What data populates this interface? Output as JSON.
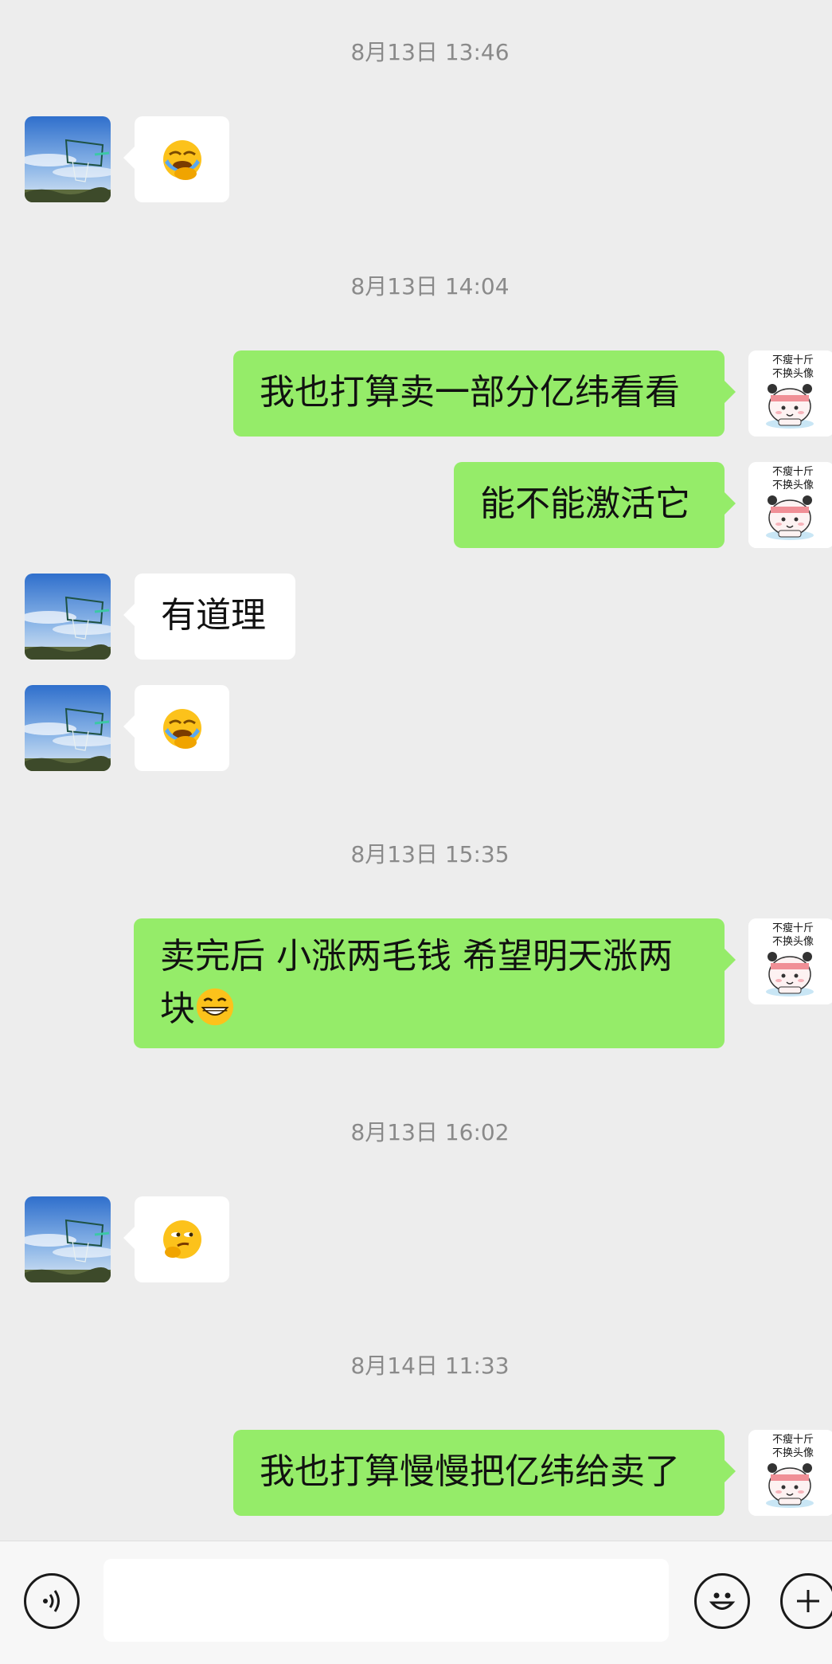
{
  "timestamps": [
    "8月13日 13:46",
    "8月13日 14:04",
    "8月13日 15:35",
    "8月13日 16:02",
    "8月14日 11:33"
  ],
  "messages": {
    "m2": "我也打算卖一部分亿纬看看",
    "m3": "能不能激活它",
    "m4": "有道理",
    "m6": "卖完后 小涨两毛钱  希望明天涨两块",
    "m8": "我也打算慢慢把亿纬给卖了"
  },
  "emoji_names": {
    "m1": "facepalm-laugh-emoji",
    "m5": "facepalm-laugh-emoji",
    "m6_tail": "grin-emoji",
    "m7": "smirk-emoji"
  },
  "me_avatar_caption": "不瘦十斤\n不换头像",
  "colors": {
    "sent_bubble": "#95ec69",
    "received_bubble": "#ffffff",
    "background": "#ededed"
  }
}
